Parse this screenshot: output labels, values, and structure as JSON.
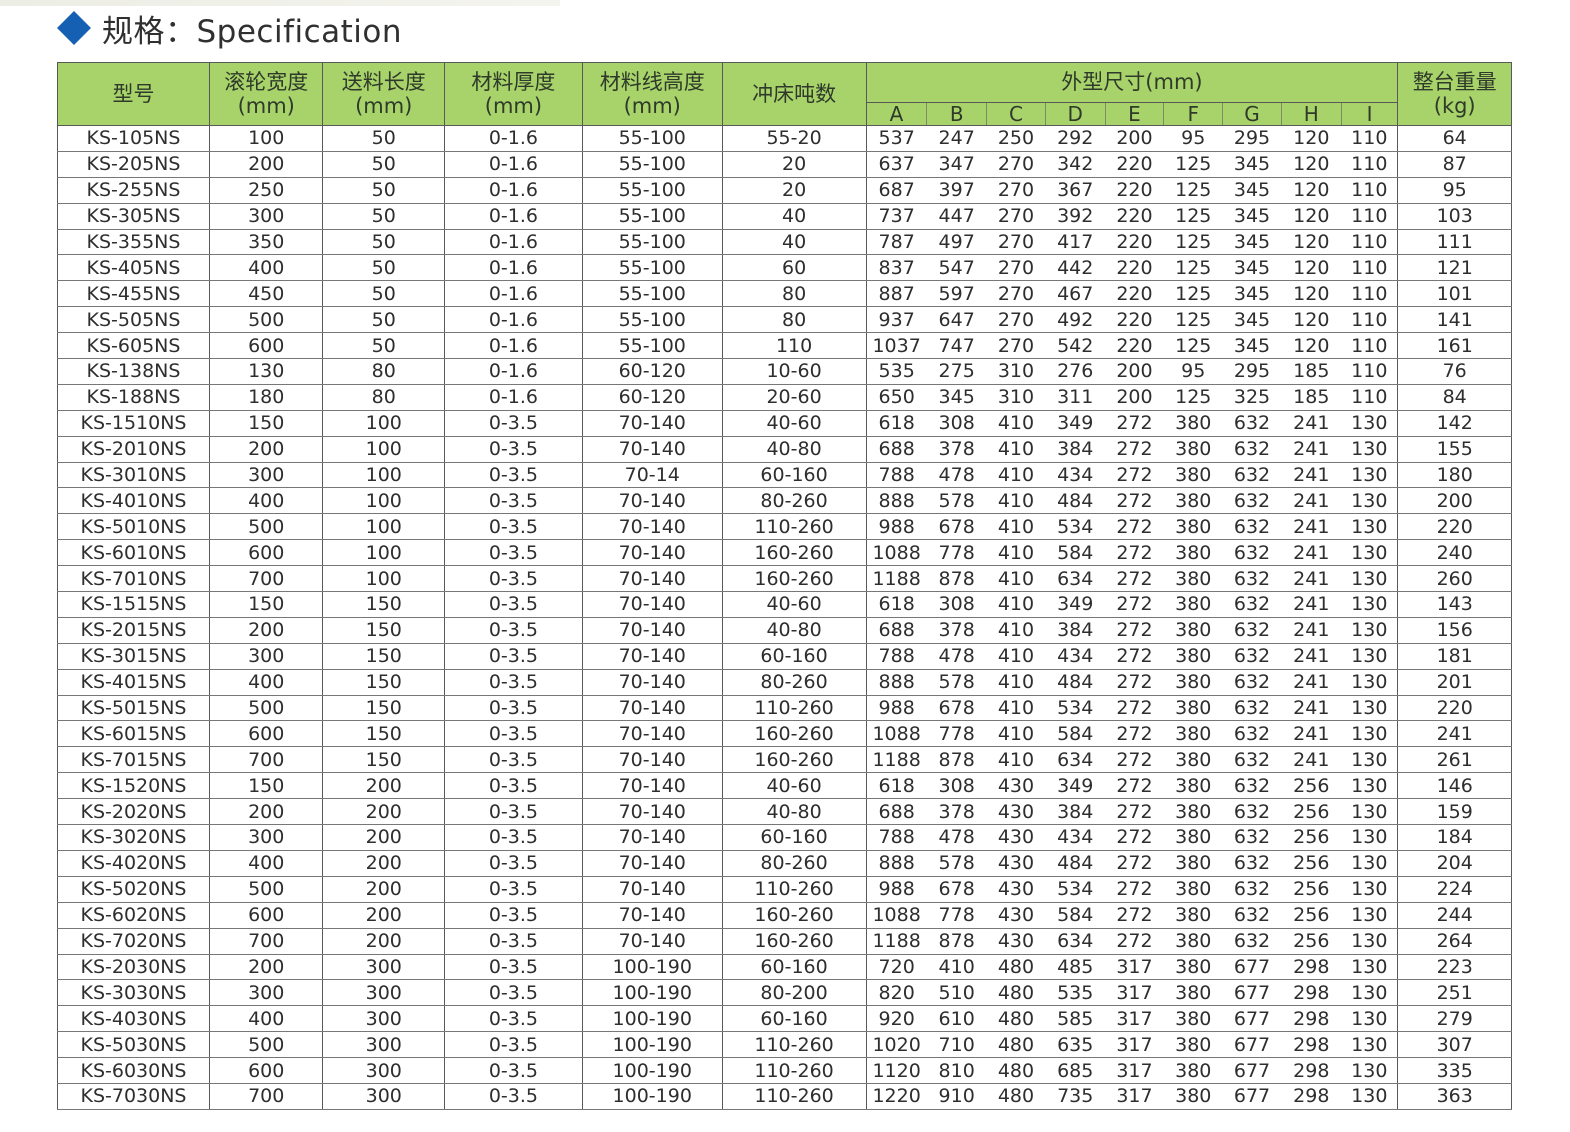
{
  "section": {
    "title": "规格：Specification"
  },
  "table": {
    "headers": {
      "model": "型号",
      "roller_width": [
        "滚轮宽度",
        "(mm)"
      ],
      "feed_length": [
        "送料长度",
        "(mm)"
      ],
      "material_thickness": [
        "材料厚度",
        "(mm)"
      ],
      "feed_line_height": [
        "材料线高度",
        "(mm)"
      ],
      "press_tonnage": "冲床吨数",
      "dimensions": "外型尺寸(mm)",
      "dimension_letters": [
        "A",
        "B",
        "C",
        "D",
        "E",
        "F",
        "G",
        "H",
        "I"
      ],
      "weight": [
        "整台重量",
        "(kg)"
      ]
    },
    "rows": [
      [
        "KS-105NS",
        "100",
        "50",
        "0-1.6",
        "55-100",
        "55-20",
        "537",
        "247",
        "250",
        "292",
        "200",
        "95",
        "295",
        "120",
        "110",
        "64"
      ],
      [
        "KS-205NS",
        "200",
        "50",
        "0-1.6",
        "55-100",
        "20",
        "637",
        "347",
        "270",
        "342",
        "220",
        "125",
        "345",
        "120",
        "110",
        "87"
      ],
      [
        "KS-255NS",
        "250",
        "50",
        "0-1.6",
        "55-100",
        "20",
        "687",
        "397",
        "270",
        "367",
        "220",
        "125",
        "345",
        "120",
        "110",
        "95"
      ],
      [
        "KS-305NS",
        "300",
        "50",
        "0-1.6",
        "55-100",
        "40",
        "737",
        "447",
        "270",
        "392",
        "220",
        "125",
        "345",
        "120",
        "110",
        "103"
      ],
      [
        "KS-355NS",
        "350",
        "50",
        "0-1.6",
        "55-100",
        "40",
        "787",
        "497",
        "270",
        "417",
        "220",
        "125",
        "345",
        "120",
        "110",
        "111"
      ],
      [
        "KS-405NS",
        "400",
        "50",
        "0-1.6",
        "55-100",
        "60",
        "837",
        "547",
        "270",
        "442",
        "220",
        "125",
        "345",
        "120",
        "110",
        "121"
      ],
      [
        "KS-455NS",
        "450",
        "50",
        "0-1.6",
        "55-100",
        "80",
        "887",
        "597",
        "270",
        "467",
        "220",
        "125",
        "345",
        "120",
        "110",
        "101"
      ],
      [
        "KS-505NS",
        "500",
        "50",
        "0-1.6",
        "55-100",
        "80",
        "937",
        "647",
        "270",
        "492",
        "220",
        "125",
        "345",
        "120",
        "110",
        "141"
      ],
      [
        "KS-605NS",
        "600",
        "50",
        "0-1.6",
        "55-100",
        "110",
        "1037",
        "747",
        "270",
        "542",
        "220",
        "125",
        "345",
        "120",
        "110",
        "161"
      ],
      [
        "KS-138NS",
        "130",
        "80",
        "0-1.6",
        "60-120",
        "10-60",
        "535",
        "275",
        "310",
        "276",
        "200",
        "95",
        "295",
        "185",
        "110",
        "76"
      ],
      [
        "KS-188NS",
        "180",
        "80",
        "0-1.6",
        "60-120",
        "20-60",
        "650",
        "345",
        "310",
        "311",
        "200",
        "125",
        "325",
        "185",
        "110",
        "84"
      ],
      [
        "KS-1510NS",
        "150",
        "100",
        "0-3.5",
        "70-140",
        "40-60",
        "618",
        "308",
        "410",
        "349",
        "272",
        "380",
        "632",
        "241",
        "130",
        "142"
      ],
      [
        "KS-2010NS",
        "200",
        "100",
        "0-3.5",
        "70-140",
        "40-80",
        "688",
        "378",
        "410",
        "384",
        "272",
        "380",
        "632",
        "241",
        "130",
        "155"
      ],
      [
        "KS-3010NS",
        "300",
        "100",
        "0-3.5",
        "70-14",
        "60-160",
        "788",
        "478",
        "410",
        "434",
        "272",
        "380",
        "632",
        "241",
        "130",
        "180"
      ],
      [
        "KS-4010NS",
        "400",
        "100",
        "0-3.5",
        "70-140",
        "80-260",
        "888",
        "578",
        "410",
        "484",
        "272",
        "380",
        "632",
        "241",
        "130",
        "200"
      ],
      [
        "KS-5010NS",
        "500",
        "100",
        "0-3.5",
        "70-140",
        "110-260",
        "988",
        "678",
        "410",
        "534",
        "272",
        "380",
        "632",
        "241",
        "130",
        "220"
      ],
      [
        "KS-6010NS",
        "600",
        "100",
        "0-3.5",
        "70-140",
        "160-260",
        "1088",
        "778",
        "410",
        "584",
        "272",
        "380",
        "632",
        "241",
        "130",
        "240"
      ],
      [
        "KS-7010NS",
        "700",
        "100",
        "0-3.5",
        "70-140",
        "160-260",
        "1188",
        "878",
        "410",
        "634",
        "272",
        "380",
        "632",
        "241",
        "130",
        "260"
      ],
      [
        "KS-1515NS",
        "150",
        "150",
        "0-3.5",
        "70-140",
        "40-60",
        "618",
        "308",
        "410",
        "349",
        "272",
        "380",
        "632",
        "241",
        "130",
        "143"
      ],
      [
        "KS-2015NS",
        "200",
        "150",
        "0-3.5",
        "70-140",
        "40-80",
        "688",
        "378",
        "410",
        "384",
        "272",
        "380",
        "632",
        "241",
        "130",
        "156"
      ],
      [
        "KS-3015NS",
        "300",
        "150",
        "0-3.5",
        "70-140",
        "60-160",
        "788",
        "478",
        "410",
        "434",
        "272",
        "380",
        "632",
        "241",
        "130",
        "181"
      ],
      [
        "KS-4015NS",
        "400",
        "150",
        "0-3.5",
        "70-140",
        "80-260",
        "888",
        "578",
        "410",
        "484",
        "272",
        "380",
        "632",
        "241",
        "130",
        "201"
      ],
      [
        "KS-5015NS",
        "500",
        "150",
        "0-3.5",
        "70-140",
        "110-260",
        "988",
        "678",
        "410",
        "534",
        "272",
        "380",
        "632",
        "241",
        "130",
        "220"
      ],
      [
        "KS-6015NS",
        "600",
        "150",
        "0-3.5",
        "70-140",
        "160-260",
        "1088",
        "778",
        "410",
        "584",
        "272",
        "380",
        "632",
        "241",
        "130",
        "241"
      ],
      [
        "KS-7015NS",
        "700",
        "150",
        "0-3.5",
        "70-140",
        "160-260",
        "1188",
        "878",
        "410",
        "634",
        "272",
        "380",
        "632",
        "241",
        "130",
        "261"
      ],
      [
        "KS-1520NS",
        "150",
        "200",
        "0-3.5",
        "70-140",
        "40-60",
        "618",
        "308",
        "430",
        "349",
        "272",
        "380",
        "632",
        "256",
        "130",
        "146"
      ],
      [
        "KS-2020NS",
        "200",
        "200",
        "0-3.5",
        "70-140",
        "40-80",
        "688",
        "378",
        "430",
        "384",
        "272",
        "380",
        "632",
        "256",
        "130",
        "159"
      ],
      [
        "KS-3020NS",
        "300",
        "200",
        "0-3.5",
        "70-140",
        "60-160",
        "788",
        "478",
        "430",
        "434",
        "272",
        "380",
        "632",
        "256",
        "130",
        "184"
      ],
      [
        "KS-4020NS",
        "400",
        "200",
        "0-3.5",
        "70-140",
        "80-260",
        "888",
        "578",
        "430",
        "484",
        "272",
        "380",
        "632",
        "256",
        "130",
        "204"
      ],
      [
        "KS-5020NS",
        "500",
        "200",
        "0-3.5",
        "70-140",
        "110-260",
        "988",
        "678",
        "430",
        "534",
        "272",
        "380",
        "632",
        "256",
        "130",
        "224"
      ],
      [
        "KS-6020NS",
        "600",
        "200",
        "0-3.5",
        "70-140",
        "160-260",
        "1088",
        "778",
        "430",
        "584",
        "272",
        "380",
        "632",
        "256",
        "130",
        "244"
      ],
      [
        "KS-7020NS",
        "700",
        "200",
        "0-3.5",
        "70-140",
        "160-260",
        "1188",
        "878",
        "430",
        "634",
        "272",
        "380",
        "632",
        "256",
        "130",
        "264"
      ],
      [
        "KS-2030NS",
        "200",
        "300",
        "0-3.5",
        "100-190",
        "60-160",
        "720",
        "410",
        "480",
        "485",
        "317",
        "380",
        "677",
        "298",
        "130",
        "223"
      ],
      [
        "KS-3030NS",
        "300",
        "300",
        "0-3.5",
        "100-190",
        "80-200",
        "820",
        "510",
        "480",
        "535",
        "317",
        "380",
        "677",
        "298",
        "130",
        "251"
      ],
      [
        "KS-4030NS",
        "400",
        "300",
        "0-3.5",
        "100-190",
        "60-160",
        "920",
        "610",
        "480",
        "585",
        "317",
        "380",
        "677",
        "298",
        "130",
        "279"
      ],
      [
        "KS-5030NS",
        "500",
        "300",
        "0-3.5",
        "100-190",
        "110-260",
        "1020",
        "710",
        "480",
        "635",
        "317",
        "380",
        "677",
        "298",
        "130",
        "307"
      ],
      [
        "KS-6030NS",
        "600",
        "300",
        "0-3.5",
        "100-190",
        "110-260",
        "1120",
        "810",
        "480",
        "685",
        "317",
        "380",
        "677",
        "298",
        "130",
        "335"
      ],
      [
        "KS-7030NS",
        "700",
        "300",
        "0-3.5",
        "100-190",
        "110-260",
        "1220",
        "910",
        "480",
        "735",
        "317",
        "380",
        "677",
        "298",
        "130",
        "363"
      ]
    ]
  },
  "colors": {
    "header_green": "#a7d36a",
    "diamond_blue": "#1560b3",
    "grid_line": "#595959"
  }
}
